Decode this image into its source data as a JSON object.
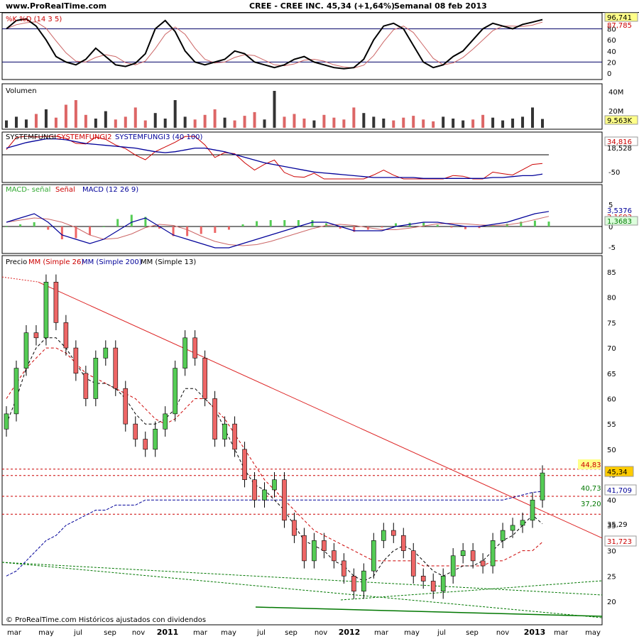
{
  "header": {
    "site": "www.ProRealTime.com",
    "ticker": "CREE - CREE INC.",
    "price": "45,34 (+1,64%)",
    "period": "Semanal  08 feb 2013"
  },
  "panels": {
    "stoch": {
      "title": "%K %D (14 3 5)",
      "axis": [
        "80",
        "60",
        "40",
        "20",
        "0"
      ],
      "value": "96,741",
      "value2": "87,785"
    },
    "volume": {
      "title": "Volumen",
      "axis": [
        "40M",
        "20M"
      ],
      "value": "9.563K"
    },
    "fungi": {
      "title_a": "SYSTEMFUNGI",
      "title_b": "SYSTEMFUNGI2",
      "title_c": "SYSTEMFUNGI3 (40 100)",
      "axis": [
        "-50"
      ],
      "value": "34,816",
      "value2": "18,528"
    },
    "macd": {
      "title_a": "MACD- señal",
      "title_b": "Señal",
      "title_c": "MACD (12 26 9)",
      "axis": [
        "5",
        "0",
        "-5"
      ],
      "value": "3,5376",
      "value2": "2,1693",
      "value3": "1,3683"
    },
    "price": {
      "title_a": "Precio",
      "title_b": "MM (Simple 26)",
      "title_c": "MM (Simple 200)",
      "title_d": "MM (Simple 13)",
      "axis": [
        "85",
        "80",
        "75",
        "70",
        "65",
        "60",
        "55",
        "50",
        "45",
        "40",
        "35",
        "30",
        "25",
        "20"
      ],
      "last": "45,34",
      "resistance": "44,83",
      "level_4073": "40,73",
      "ma200": "41,709",
      "level_3720": "37,20",
      "ma26": "35,29",
      "ma13": "31,723",
      "footer": "© ProRealTime.com  Históricos ajustados con dividendos"
    }
  },
  "time_axis": [
    "mar",
    "may",
    "jul",
    "sep",
    "nov",
    "2011",
    "mar",
    "may",
    "jul",
    "sep",
    "nov",
    "2012",
    "mar",
    "may",
    "jul",
    "sep",
    "nov",
    "2013",
    "mar",
    "may"
  ],
  "colors": {
    "up": "#55cc55",
    "down": "#ee6666",
    "ma26": "#cc0000",
    "ma200": "#000099",
    "ma13": "#000000",
    "trend": "#dd2222",
    "support": "#007700",
    "hilite": "#ffff88"
  },
  "chart_data": {
    "type": "line",
    "title": "CREE - CREE INC.",
    "xlabel": "",
    "ylabel": "",
    "ylim": [
      18,
      87
    ],
    "x_ticks": [
      "mar",
      "may",
      "jul",
      "sep",
      "nov",
      "2011",
      "mar",
      "may",
      "jul",
      "sep",
      "nov",
      "2012",
      "mar",
      "may",
      "jul",
      "sep",
      "nov",
      "2013",
      "mar",
      "may"
    ],
    "series": [
      {
        "name": "Precio",
        "values": [
          57,
          66,
          73,
          72,
          83,
          75,
          70,
          65,
          60,
          68,
          70,
          62,
          55,
          52,
          50,
          54,
          57,
          66,
          72,
          68,
          60,
          52,
          55,
          50,
          44,
          40,
          42,
          44,
          36,
          33,
          28,
          32,
          30,
          28,
          25,
          22,
          26,
          32,
          34,
          33,
          30,
          25,
          24,
          22,
          25,
          29,
          30,
          28,
          27,
          32,
          34,
          35,
          36,
          40,
          45.34
        ]
      },
      {
        "name": "MM (Simple 26)",
        "values": [
          60,
          63,
          66,
          68,
          70,
          70,
          69,
          67,
          65,
          64,
          63,
          62,
          61,
          60,
          58,
          56,
          55,
          56,
          58,
          60,
          60,
          58,
          56,
          53,
          50,
          47,
          44,
          42,
          40,
          38,
          36,
          34,
          33,
          32,
          31,
          30,
          29,
          28,
          28,
          28,
          28,
          28,
          27,
          27,
          27,
          27,
          27,
          27,
          27,
          28,
          28,
          29,
          30,
          30,
          31.7
        ]
      },
      {
        "name": "MM (Simple 200)",
        "values": [
          25,
          26,
          28,
          30,
          32,
          33,
          35,
          36,
          37,
          38,
          38,
          39,
          39,
          39,
          40,
          40,
          40,
          40,
          40,
          40,
          40,
          40,
          40,
          40,
          40,
          40,
          40,
          40,
          40,
          40,
          40,
          40,
          40,
          40,
          40,
          40,
          40,
          40,
          40,
          40,
          40,
          40,
          40,
          40,
          40,
          40,
          40,
          40,
          40,
          40,
          40,
          40.5,
          41,
          41.5,
          41.7
        ]
      },
      {
        "name": "MM (Simple 13)",
        "values": [
          55,
          60,
          66,
          70,
          72,
          72,
          70,
          67,
          64,
          63,
          63,
          62,
          60,
          57,
          55,
          55,
          56,
          58,
          62,
          62,
          60,
          58,
          54,
          50,
          46,
          43,
          42,
          40,
          38,
          35,
          32,
          31,
          30,
          28,
          27,
          25,
          24,
          25,
          28,
          30,
          31,
          30,
          28,
          26,
          25,
          26,
          27,
          27,
          28,
          30,
          32,
          33,
          35,
          37,
          35.3
        ]
      }
    ],
    "stoch_k": [
      80,
      95,
      98,
      85,
      60,
      30,
      20,
      15,
      25,
      45,
      30,
      15,
      12,
      18,
      35,
      80,
      95,
      75,
      40,
      20,
      15,
      20,
      25,
      40,
      35,
      20,
      15,
      10,
      15,
      25,
      30,
      20,
      15,
      10,
      8,
      10,
      25,
      60,
      85,
      90,
      80,
      50,
      20,
      10,
      15,
      30,
      40,
      60,
      80,
      90,
      85,
      80,
      88,
      92,
      96.7
    ],
    "volume_m": [
      8,
      12,
      9,
      15,
      20,
      11,
      25,
      30,
      14,
      10,
      18,
      9,
      12,
      22,
      8,
      16,
      10,
      30,
      12,
      9,
      14,
      20,
      11,
      8,
      13,
      17,
      9,
      40,
      12,
      15,
      10,
      8,
      14,
      11,
      9,
      22,
      16,
      12,
      10,
      8,
      11,
      13,
      9,
      7,
      12,
      10,
      8,
      9,
      14,
      11,
      8,
      10,
      12,
      22,
      9.563
    ],
    "macd": [
      1,
      2,
      3,
      1,
      -2,
      -3,
      -4,
      -3,
      -1,
      1,
      2,
      0,
      -2,
      -3,
      -4,
      -5,
      -5,
      -4,
      -3,
      -2,
      -1,
      0,
      1,
      1,
      0,
      -1,
      -1,
      -1,
      0,
      0.5,
      1,
      1,
      0.5,
      0,
      0,
      0.5,
      1,
      2,
      3,
      3.54
    ],
    "levels": {
      "resistance": 44.83,
      "l1": 40.73,
      "l2": 37.2
    },
    "trendline": {
      "from": [
        0,
        83
      ],
      "to": [
        54,
        36
      ]
    }
  }
}
